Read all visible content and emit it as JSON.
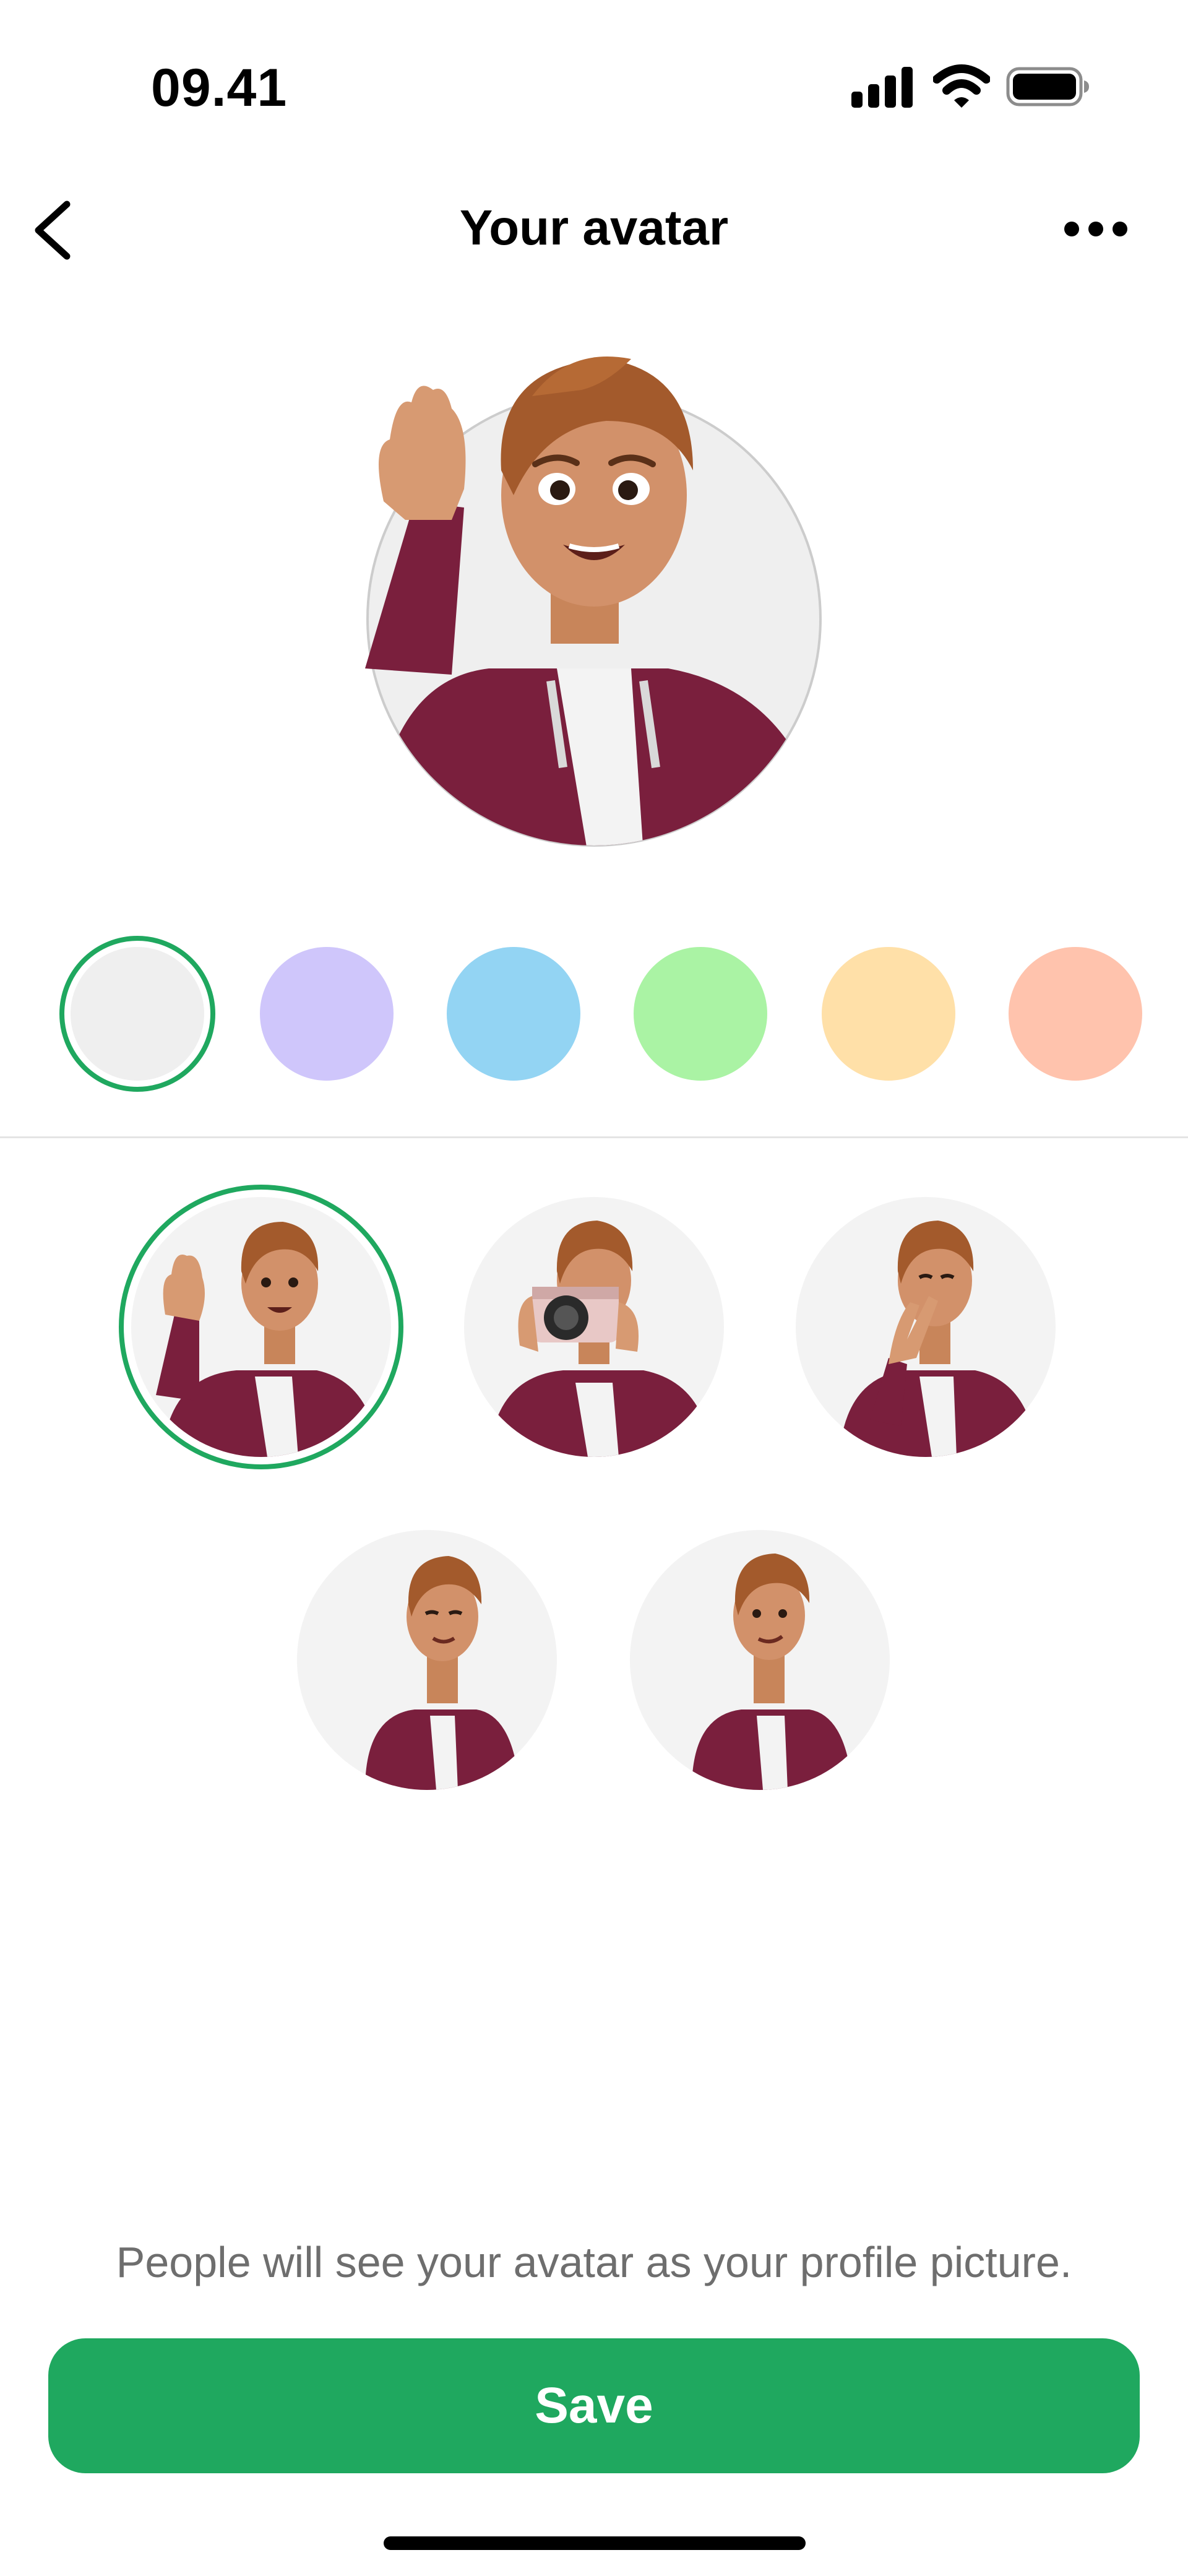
{
  "status_bar": {
    "time": "09.41",
    "icons": [
      "signal-icon",
      "wifi-icon",
      "battery-icon"
    ]
  },
  "nav": {
    "title": "Your avatar",
    "back_icon": "chevron-left-icon",
    "more_icon": "more-horizontal-icon"
  },
  "background_colors": {
    "selected_index": 0,
    "swatches": [
      "#efefef",
      "#cfc6fb",
      "#93d4f3",
      "#aaf3a4",
      "#ffe0a8",
      "#ffc3ad"
    ],
    "accent": "#1fa85f"
  },
  "poses": {
    "selected_index": 0,
    "items": [
      "wave",
      "camera",
      "peace-sign",
      "smile",
      "confident"
    ]
  },
  "caption": "People will see your avatar as your profile picture.",
  "save_label": "Save"
}
